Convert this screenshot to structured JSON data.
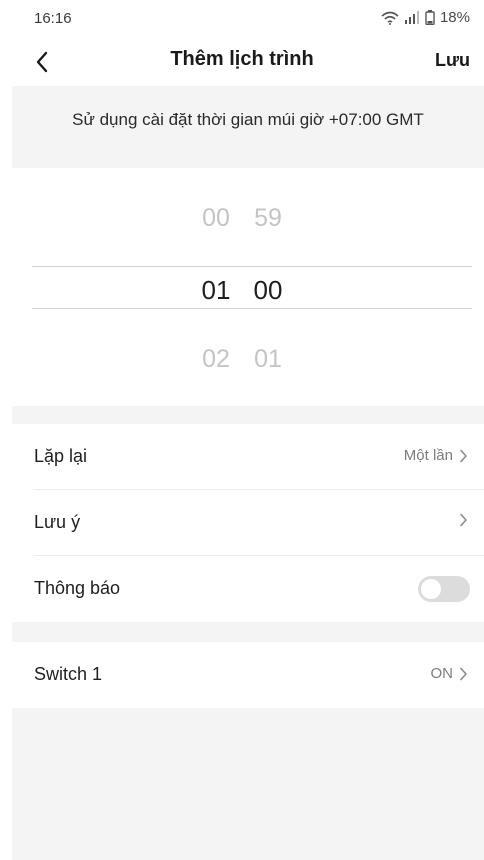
{
  "status_bar": {
    "time": "16:16",
    "battery": "18%",
    "icons": [
      "wifi-icon",
      "signal-icon",
      "battery-icon"
    ]
  },
  "header": {
    "back_icon": "chevron-left-icon",
    "title": "Thêm lịch trình",
    "save_label": "Lưu"
  },
  "timezone": {
    "text": "Sử dụng cài đặt thời gian múi giờ +07:00 GMT"
  },
  "time_picker": {
    "rows": [
      {
        "hour": "00",
        "minute": "59",
        "selected": false
      },
      {
        "hour": "01",
        "minute": "00",
        "selected": true
      },
      {
        "hour": "02",
        "minute": "01",
        "selected": false
      }
    ]
  },
  "settings": {
    "repeat": {
      "label": "Lặp lại",
      "value": "Một lần"
    },
    "note": {
      "label": "Lưu ý",
      "value": ""
    },
    "notification": {
      "label": "Thông báo",
      "enabled": false
    }
  },
  "actions": {
    "switch": {
      "label": "Switch 1",
      "value": "ON"
    }
  },
  "colors": {
    "background": "#ffffff",
    "band": "#f4f4f4",
    "text": "#1f1f1f",
    "muted": "#7c7c7c",
    "faded_picker": "#c4c4c4",
    "toggle_off": "#dcdcdc"
  }
}
